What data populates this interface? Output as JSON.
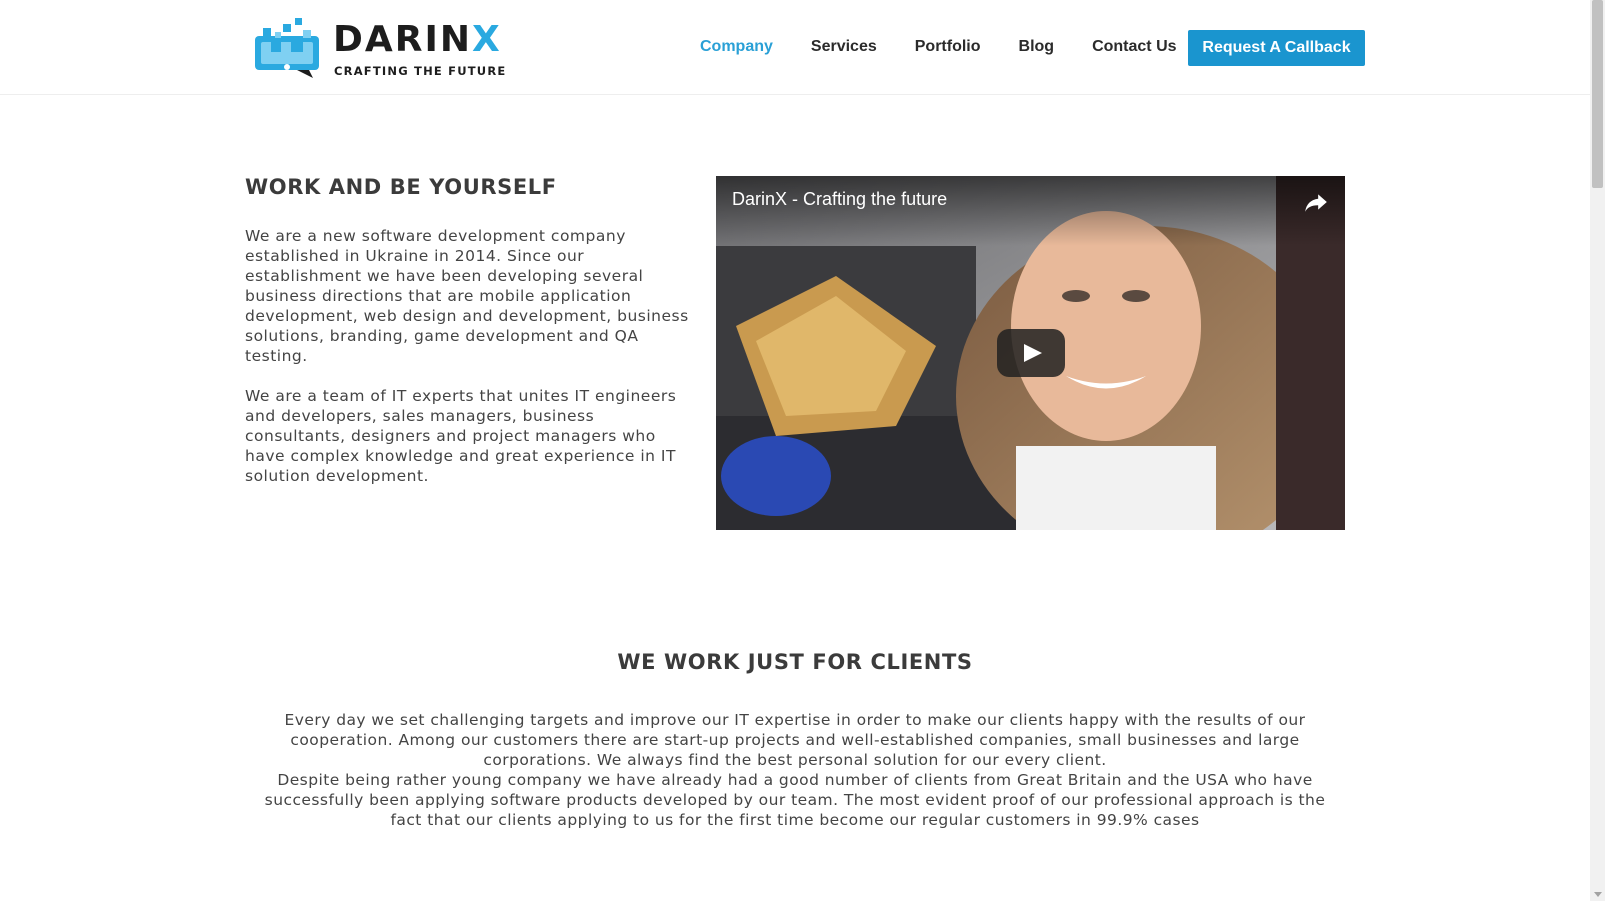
{
  "brand": {
    "name_main": "DARIN",
    "name_accent": "X",
    "tagline": "CRAFTING THE FUTURE",
    "accent_color": "#2aa9e0"
  },
  "nav": {
    "items": [
      {
        "label": "Company",
        "active": true
      },
      {
        "label": "Services",
        "active": false
      },
      {
        "label": "Portfolio",
        "active": false
      },
      {
        "label": "Blog",
        "active": false
      },
      {
        "label": "Contact Us",
        "active": false
      }
    ],
    "cta_label": "Request A Callback",
    "active_color": "#2aa0d6",
    "cta_color": "#1a95cf"
  },
  "section_about": {
    "title": "WORK AND BE YOURSELF",
    "paragraphs": [
      "We are a new software development company established in Ukraine in 2014. Since our establishment we have been developing several business directions that are mobile application development, web design and development, business solutions, branding, game development and QA testing.",
      "We are a team of IT experts that unites IT engineers and developers, sales managers, business consultants, designers and project managers who have complex knowledge and great experience in IT solution development."
    ]
  },
  "video": {
    "title": "DarinX - Crafting the future",
    "share_icon": "share-arrow-icon",
    "play_icon": "play-icon"
  },
  "section_clients": {
    "title": "WE WORK JUST FOR CLIENTS",
    "paragraphs": [
      "Every day we set challenging targets and improve our IT expertise in order to make our clients happy with the results of our cooperation. Among our customers there are start-up projects and well-established companies, small businesses and large corporations. We always find the best personal solution for our every client.",
      "Despite being rather young company we have already had a good number of clients from Great Britain and the USA who have successfully been applying software products developed by our team. The most evident proof of our professional approach is the fact that our clients applying to us for the first time become our regular customers in 99.9% cases"
    ]
  }
}
